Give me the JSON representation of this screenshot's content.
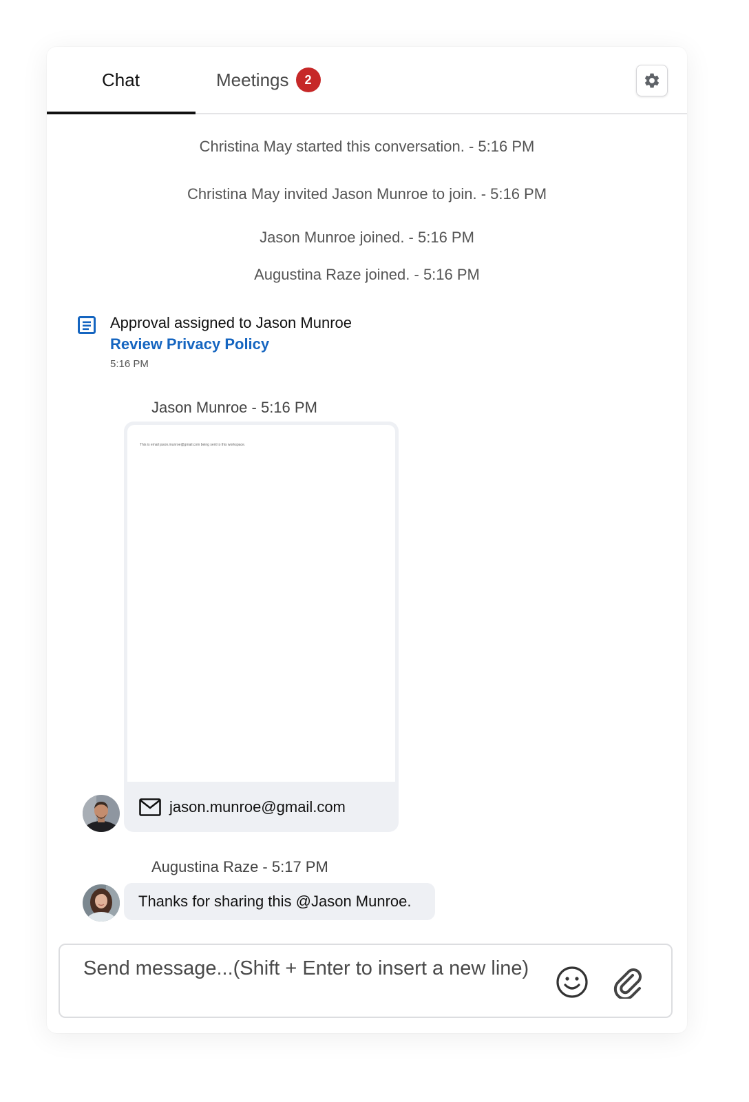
{
  "tabs": {
    "chat_label": "Chat",
    "meetings_label": "Meetings",
    "meetings_badge": "2"
  },
  "icons": {
    "settings": "gear-icon",
    "approval": "document-icon",
    "attachment_mail": "mail-icon",
    "emoji": "emoji-icon",
    "attach": "paperclip-icon"
  },
  "colors": {
    "badge": "#c62828",
    "link": "#1565c0",
    "active_tab_underline": "#111111",
    "bubble": "#eef0f4"
  },
  "system_events": [
    {
      "text": "Christina May started this conversation. - 5:16 PM"
    },
    {
      "text": "Christina May invited Jason Munroe  to join. - 5:16 PM"
    },
    {
      "text": "Jason Munroe  joined. - 5:16 PM"
    },
    {
      "text": "Augustina Raze  joined. - 5:16 PM"
    }
  ],
  "approval": {
    "text": "Approval assigned to Jason Munroe",
    "link": "Review Privacy Policy",
    "time": "5:16 PM"
  },
  "messages": [
    {
      "header": "Jason Munroe - 5:16 PM",
      "attachment_preview_text": "This is email jason.munroe@gmail.com being sent to this workspace.",
      "attachment_email": "jason.munroe@gmail.com"
    },
    {
      "header": "Augustina Raze - 5:17 PM",
      "text": "Thanks for sharing this @Jason Munroe."
    }
  ],
  "composer": {
    "placeholder": "Send message...(Shift + Enter to insert a new line)"
  }
}
